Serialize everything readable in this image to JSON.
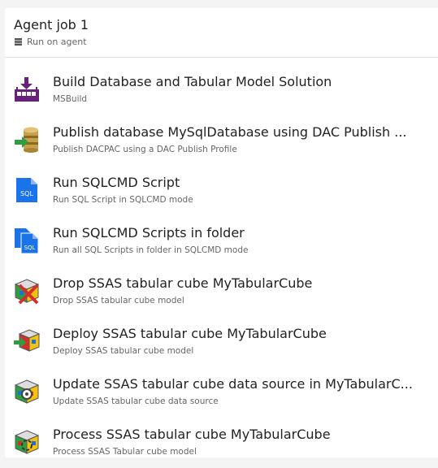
{
  "job": {
    "title": "Agent job 1",
    "subtitle": "Run on agent",
    "icon": "server-icon"
  },
  "tasks": [
    {
      "title": "Build Database and Tabular Model Solution",
      "subtitle": "MSBuild",
      "icon": "msbuild-icon"
    },
    {
      "title": "Publish database MySqlDatabase using DAC Publish ...",
      "subtitle": "Publish DACPAC using a DAC Publish Profile",
      "icon": "database-publish-icon"
    },
    {
      "title": "Run SQLCMD Script",
      "subtitle": "Run SQL Script in SQLCMD mode",
      "icon": "sql-file-icon",
      "icon_label": "SQL"
    },
    {
      "title": "Run SQLCMD Scripts in folder",
      "subtitle": "Run all SQL Scripts in folder in SQLCMD mode",
      "icon": "sql-files-icon",
      "icon_label": "SQL"
    },
    {
      "title": "Drop SSAS tabular cube MyTabularCube",
      "subtitle": "Drop SSAS tabular cube model",
      "icon": "cube-drop-icon"
    },
    {
      "title": "Deploy SSAS tabular cube MyTabularCube",
      "subtitle": "Deploy SSAS tabular cube model",
      "icon": "cube-deploy-icon"
    },
    {
      "title": "Update SSAS tabular cube data source in MyTabularC...",
      "subtitle": "Update SSAS tabular cube data source",
      "icon": "cube-update-icon"
    },
    {
      "title": "Process SSAS tabular cube MyTabularCube",
      "subtitle": "Process SSAS Tabular cube model",
      "icon": "cube-process-icon"
    }
  ],
  "colors": {
    "msbuild": "#68217a",
    "sql_blue": "#1a73e8",
    "cube_red": "#d32f2f",
    "cube_green": "#2e9e3f",
    "cube_yellow": "#f4c20d",
    "cube_blue": "#1e6fd9"
  }
}
